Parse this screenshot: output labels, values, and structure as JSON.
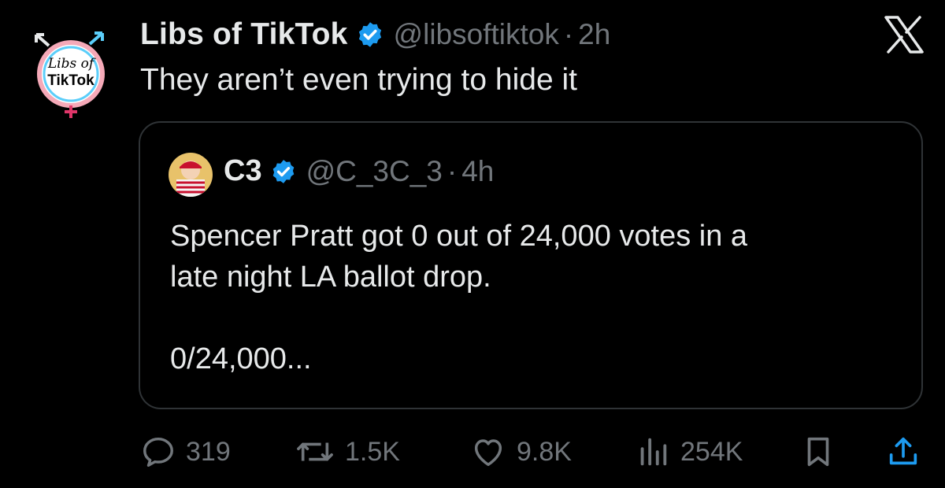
{
  "author": {
    "display_name": "Libs of TikTok",
    "handle": "@libsoftiktok",
    "separator": "·",
    "time": "2h",
    "avatar_text_line1": "Libs of",
    "avatar_text_line2": "TikTok"
  },
  "tweet": {
    "text": "They aren’t even trying to hide it"
  },
  "quoted": {
    "display_name": "C3",
    "handle": "@C_3C_3",
    "separator": "·",
    "time": "4h",
    "line1": "Spencer Pratt got 0 out of 24,000 votes in a",
    "line2": "late night LA ballot drop.",
    "line3": "0/24,000..."
  },
  "actions": {
    "replies": "319",
    "reposts": "1.5K",
    "likes": "9.8K",
    "views": "254K"
  },
  "icons": {
    "verified": "verified-badge-icon",
    "close": "x-logo-icon",
    "reply": "reply-icon",
    "repost": "repost-icon",
    "like": "heart-icon",
    "views": "views-icon",
    "bookmark": "bookmark-icon",
    "share": "share-icon"
  },
  "colors": {
    "background": "#000000",
    "text": "#e7e9ea",
    "muted": "#71767b",
    "verified": "#1d9bf0",
    "border": "#2f3336"
  }
}
